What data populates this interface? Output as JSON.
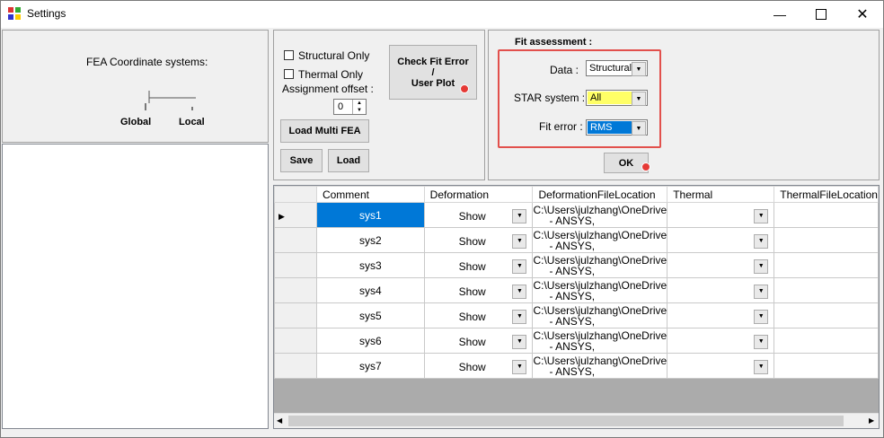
{
  "window": {
    "title": "Settings"
  },
  "coord": {
    "title": "FEA Coordinate systems:",
    "global_label": "Global",
    "local_label": "Local"
  },
  "options": {
    "structural_only": "Structural Only",
    "thermal_only": "Thermal Only",
    "assignment_offset": "Assignment offset :",
    "offset_value": "0",
    "check_fit_line1": "Check Fit Error",
    "check_fit_line2": "/",
    "check_fit_line3": "User Plot",
    "load_multi": "Load Multi FEA",
    "save": "Save",
    "load": "Load"
  },
  "fit": {
    "title": "Fit assessment :",
    "data_label": "Data :",
    "data_value": "Structural",
    "star_label": "STAR system :",
    "star_value": "All",
    "fit_label": "Fit error :",
    "fit_value": "RMS",
    "ok": "OK"
  },
  "grid": {
    "headers": [
      "Comment",
      "Deformation",
      "DeformationFileLocation",
      "Thermal",
      "ThermalFileLocation"
    ],
    "rows": [
      {
        "comment": "sys1",
        "deformation": "Show",
        "loc1": "C:\\Users\\julzhang\\OneDrive",
        "loc2": "- ANSYS,"
      },
      {
        "comment": "sys2",
        "deformation": "Show",
        "loc1": "C:\\Users\\julzhang\\OneDrive",
        "loc2": "- ANSYS,"
      },
      {
        "comment": "sys3",
        "deformation": "Show",
        "loc1": "C:\\Users\\julzhang\\OneDrive",
        "loc2": "- ANSYS,"
      },
      {
        "comment": "sys4",
        "deformation": "Show",
        "loc1": "C:\\Users\\julzhang\\OneDrive",
        "loc2": "- ANSYS,"
      },
      {
        "comment": "sys5",
        "deformation": "Show",
        "loc1": "C:\\Users\\julzhang\\OneDrive",
        "loc2": "- ANSYS,"
      },
      {
        "comment": "sys6",
        "deformation": "Show",
        "loc1": "C:\\Users\\julzhang\\OneDrive",
        "loc2": "- ANSYS,"
      },
      {
        "comment": "sys7",
        "deformation": "Show",
        "loc1": "C:\\Users\\julzhang\\OneDrive",
        "loc2": "- ANSYS,"
      }
    ]
  },
  "colors": {
    "accent": "#0078d7",
    "highlight": "#ffff66",
    "annotation": "#e2504c"
  }
}
